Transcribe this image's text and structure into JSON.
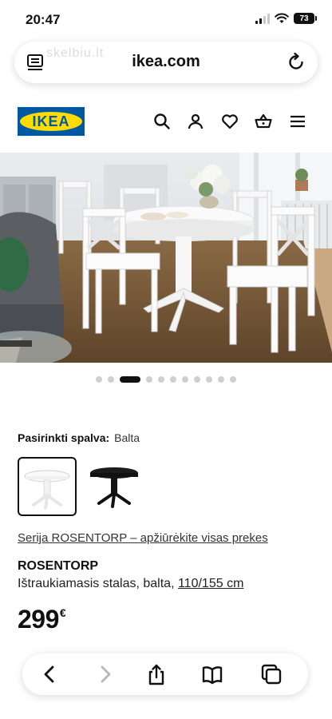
{
  "status": {
    "time": "20:47",
    "battery": "73"
  },
  "browser": {
    "url": "ikea.com",
    "watermark": "skelbiu.lt",
    "icons": {
      "reader": "reader-icon",
      "reload": "reload-icon"
    }
  },
  "header": {
    "logo_text": "IKEA",
    "icons": [
      "search-icon",
      "user-icon",
      "heart-icon",
      "cart-icon",
      "menu-icon"
    ]
  },
  "carousel": {
    "count": 11,
    "active_index": 2
  },
  "product": {
    "color_label": "Pasirinkti spalva:",
    "color_value": "Balta",
    "swatches": [
      "white-table-swatch",
      "black-table-swatch"
    ],
    "series_link": "Serija ROSENTORP – apžiūrėkite visas prekes",
    "name": "ROSENTORP",
    "description": "Ištraukiamasis stalas, balta, ",
    "size": "110/155 cm",
    "price": "299",
    "currency": "€"
  },
  "toolbar": {
    "icons": [
      "back-icon",
      "forward-icon",
      "share-icon",
      "bookmarks-icon",
      "tabs-icon"
    ]
  },
  "colors": {
    "ikea_blue": "#0058a3",
    "ikea_yellow": "#ffdb00"
  }
}
